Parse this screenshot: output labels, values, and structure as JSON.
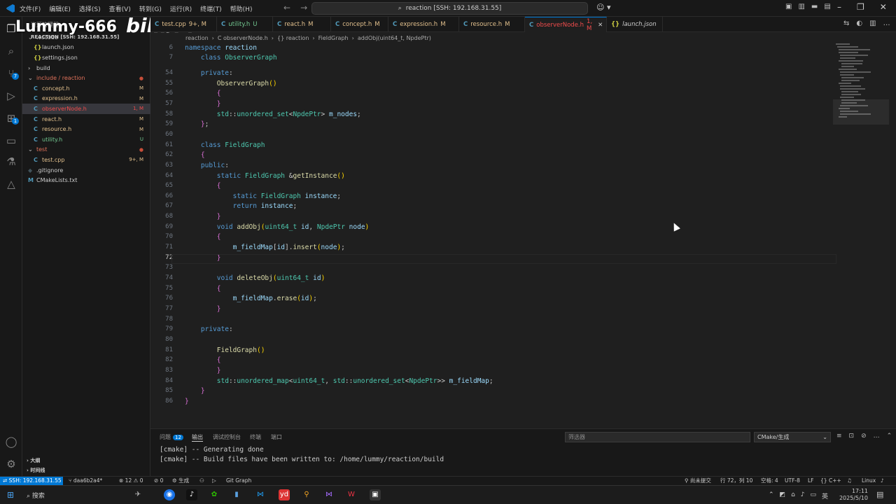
{
  "titlebar": {
    "menu": [
      "文件(F)",
      "编辑(E)",
      "选择(S)",
      "查看(V)",
      "转到(G)",
      "运行(R)",
      "终端(T)",
      "帮助(H)"
    ],
    "command_center": "reaction [SSH: 192.168.31.55]"
  },
  "watermark": {
    "text": "Lummy-666",
    "logo": "bilibili"
  },
  "sidebar": {
    "header": "资源管理器",
    "root": "REACTION [SSH: 192.168.31.55]",
    "items": [
      {
        "label": ".vscode",
        "kind": "folder",
        "status": ""
      },
      {
        "label": "launch.json",
        "kind": "json",
        "status": ""
      },
      {
        "label": "settings.json",
        "kind": "json",
        "status": ""
      },
      {
        "label": "build",
        "kind": "folder",
        "status": ""
      },
      {
        "label": "include / reaction",
        "kind": "folder",
        "status": "●"
      },
      {
        "label": "concept.h",
        "kind": "c",
        "status": "M"
      },
      {
        "label": "expression.h",
        "kind": "c",
        "status": "M"
      },
      {
        "label": "observerNode.h",
        "kind": "c",
        "status": "1, M"
      },
      {
        "label": "react.h",
        "kind": "c",
        "status": "M"
      },
      {
        "label": "resource.h",
        "kind": "c",
        "status": "M"
      },
      {
        "label": "utility.h",
        "kind": "c",
        "status": "U"
      },
      {
        "label": "test",
        "kind": "folder",
        "status": "●"
      },
      {
        "label": "test.cpp",
        "kind": "c",
        "status": "9+, M"
      },
      {
        "label": ".gitignore",
        "kind": "git",
        "status": ""
      },
      {
        "label": "CMakeLists.txt",
        "kind": "cmake",
        "status": ""
      }
    ],
    "outline": "大纲",
    "timeline": "时间线"
  },
  "tabs": [
    {
      "label": "test.cpp",
      "status": "9+, M"
    },
    {
      "label": "utility.h",
      "status": "U"
    },
    {
      "label": "react.h",
      "status": "M"
    },
    {
      "label": "concept.h",
      "status": "M"
    },
    {
      "label": "expression.h",
      "status": "M"
    },
    {
      "label": "resource.h",
      "status": "M"
    },
    {
      "label": "observerNode.h",
      "status": "1, M"
    },
    {
      "label": "launch.json",
      "status": ""
    }
  ],
  "breadcrumbs": [
    "reaction",
    "C observerNode.h",
    "{} reaction",
    "FieldGraph",
    "addObj(uint64_t, NpdePtr)"
  ],
  "sticky": [
    {
      "num": "6",
      "code": "namespace reaction"
    },
    {
      "num": "7",
      "code": "    class ObserverGraph"
    }
  ],
  "code_lines": [
    {
      "num": "54",
      "code": "    private:"
    },
    {
      "num": "55",
      "code": "        ObserverGraph()"
    },
    {
      "num": "56",
      "code": "        {"
    },
    {
      "num": "57",
      "code": "        }"
    },
    {
      "num": "58",
      "code": "        std::unordered_set<NpdePtr> m_nodes;"
    },
    {
      "num": "59",
      "code": "    };"
    },
    {
      "num": "60",
      "code": ""
    },
    {
      "num": "61",
      "code": "    class FieldGraph"
    },
    {
      "num": "62",
      "code": "    {"
    },
    {
      "num": "63",
      "code": "    public:"
    },
    {
      "num": "64",
      "code": "        static FieldGraph &getInstance()"
    },
    {
      "num": "65",
      "code": "        {"
    },
    {
      "num": "66",
      "code": "            static FieldGraph instance;"
    },
    {
      "num": "67",
      "code": "            return instance;"
    },
    {
      "num": "68",
      "code": "        }"
    },
    {
      "num": "69",
      "code": "        void addObj(uint64_t id, NpdePtr node)"
    },
    {
      "num": "70",
      "code": "        {"
    },
    {
      "num": "71",
      "code": "            m_fieldMap[id].insert(node);"
    },
    {
      "num": "72",
      "code": "        }"
    },
    {
      "num": "73",
      "code": ""
    },
    {
      "num": "74",
      "code": "        void deleteObj(uint64_t id)"
    },
    {
      "num": "75",
      "code": "        {"
    },
    {
      "num": "76",
      "code": "            m_fieldMap.erase(id);"
    },
    {
      "num": "77",
      "code": "        }"
    },
    {
      "num": "78",
      "code": ""
    },
    {
      "num": "79",
      "code": "    private:"
    },
    {
      "num": "80",
      "code": ""
    },
    {
      "num": "81",
      "code": "        FieldGraph()"
    },
    {
      "num": "82",
      "code": "        {"
    },
    {
      "num": "83",
      "code": "        }"
    },
    {
      "num": "84",
      "code": "        std::unordered_map<uint64_t, std::unordered_set<NpdePtr>> m_fieldMap;"
    },
    {
      "num": "85",
      "code": "    }"
    },
    {
      "num": "86",
      "code": "}"
    }
  ],
  "panel": {
    "tabs": [
      {
        "label": "问题",
        "badge": "12"
      },
      {
        "label": "输出"
      },
      {
        "label": "调试控制台"
      },
      {
        "label": "终端"
      },
      {
        "label": "端口"
      }
    ],
    "filter_placeholder": "筛选器",
    "output_channel": "CMake/生成",
    "lines": [
      "[cmake] -- Generating done",
      "[cmake] -- Build files have been written to: /home/lummy/reaction/build"
    ]
  },
  "statusbar": {
    "remote": "SSH: 192.168.31.55",
    "branch": "daa6b2a4*",
    "errors": "12",
    "warnings": "0",
    "ports": "0",
    "build": "生成",
    "git_graph": "Git Graph",
    "commit": "尚未提交",
    "position": "行 72，列 10",
    "spaces": "空格: 4",
    "encoding": "UTF-8",
    "eol": "LF",
    "language": "C++",
    "platform": "Linux"
  },
  "taskbar": {
    "search": "搜索",
    "ime": "英",
    "time": "17:11",
    "date": "2025/5/10"
  }
}
